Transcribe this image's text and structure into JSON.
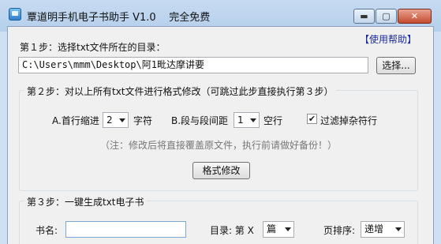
{
  "window": {
    "title": "覃道明手机电子书助手 V1.0",
    "subtitle": "完全免费",
    "minimize_glyph": "▬",
    "maximize_glyph": "▢",
    "close_glyph": "✕"
  },
  "help_link": "【使用帮助】",
  "step1": {
    "label": "第１步：选择txt文件所在的目录：",
    "path_value": "C:\\Users\\mmm\\Desktop\\阿1毗达摩讲要",
    "browse_button": "选择..."
  },
  "step2": {
    "title": "第２步：对以上所有txt文件进行格式修改（可跳过此步直接执行第３步）",
    "indent_label": "A.首行缩进",
    "indent_value": "2",
    "indent_unit": "字符",
    "spacing_label": "B.段与段间距",
    "spacing_value": "1",
    "spacing_unit": "空行",
    "filter_label": "过滤掉杂符行",
    "filter_checked": true,
    "checkmark": "✔",
    "note": "（注：修改后将直接覆盖原文件，执行前请做好备份！）",
    "format_button": "格式修改"
  },
  "step3": {
    "title": "第３步：一键生成txt电子书",
    "bookname_label": "书名:",
    "bookname_value": "",
    "toc_label": "目录: 第 X",
    "toc_value": "篇",
    "order_label": "页排序:",
    "order_value": "递增"
  }
}
